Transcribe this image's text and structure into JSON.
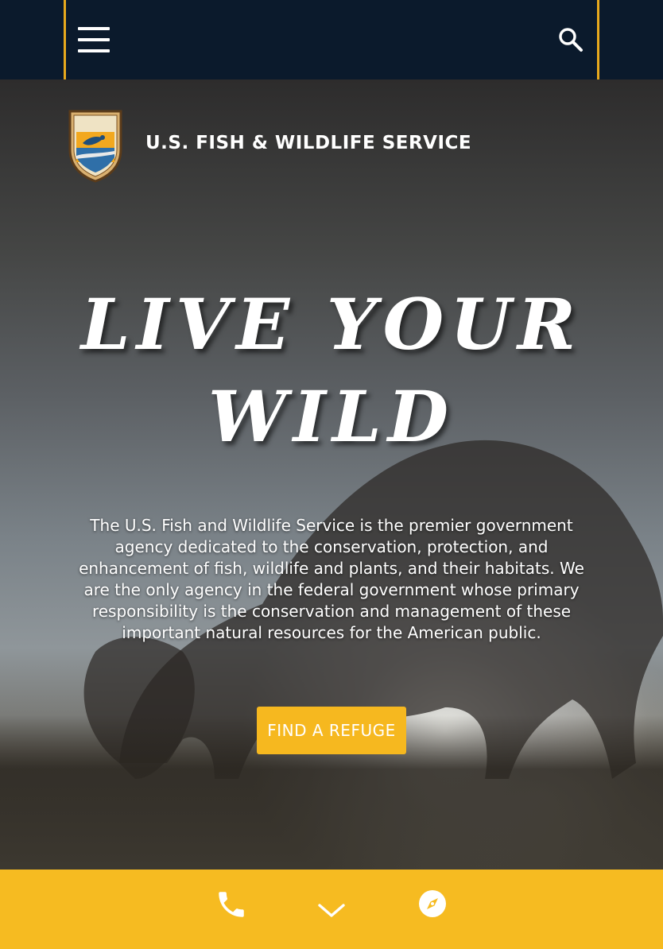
{
  "header": {
    "menu_icon": "hamburger-menu-icon",
    "search_icon": "search-icon",
    "accent_color": "#e8a91d",
    "background_color": "#0b1a2c"
  },
  "brand": {
    "logo_icon": "usfws-shield-logo",
    "name": "U.S. FISH & WILDLIFE SERVICE",
    "logo_text_top": "U.S.",
    "logo_text_middle": "FISH & WILDLIFE",
    "logo_text_bottom": "SERVICE"
  },
  "hero": {
    "headline_line1": "LIVE YOUR",
    "headline_line2": "WILD",
    "description": "The U.S. Fish and Wildlife Service is the premier government agency dedicated to the conservation, protection, and enhancement of fish, wildlife and plants, and their habitats. We are the only agency in the federal government whose primary responsibility is the conservation and management of these important natural resources for the American public.",
    "cta_label": "FIND A REFUGE",
    "cta_color": "#f6b81f"
  },
  "bottom_bar": {
    "background_color": "#f6bb21",
    "phone_icon": "phone-icon",
    "scroll_icon": "chevron-down-icon",
    "directions_icon": "compass-icon"
  }
}
